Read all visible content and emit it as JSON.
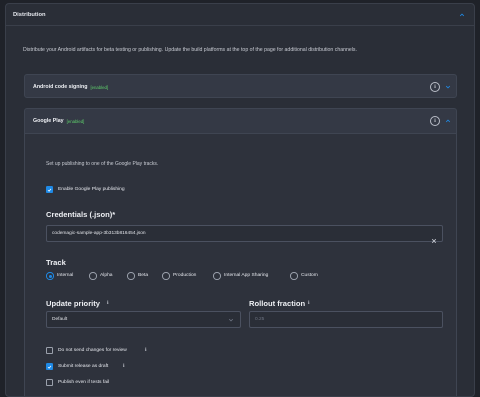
{
  "panel": {
    "title": "Distribution",
    "intro": "Distribute your Android artifacts for beta testing or publishing. Update the build platforms at the top of the page for additional distribution channels."
  },
  "signing": {
    "title": "Android code signing",
    "status": "[enabled]"
  },
  "google_play": {
    "title": "Google Play",
    "status": "[enabled]",
    "description": "Set up publishing to one of the Google Play tracks.",
    "enable_label": "Enable Google Play publishing",
    "enable_checked": true,
    "credentials": {
      "label": "Credentials (.json)*",
      "value": "codemagic-sample-app-3b313b816454.json"
    },
    "track": {
      "label": "Track",
      "options": [
        "Internal",
        "Alpha",
        "Beta",
        "Production",
        "Internal App Sharing",
        "Custom"
      ],
      "selected": "Internal"
    },
    "update_priority": {
      "label": "Update priority",
      "value": "Default"
    },
    "rollout_fraction": {
      "label": "Rollout fraction",
      "placeholder": "0.25"
    },
    "options": [
      {
        "label": "Do not send changes for review",
        "checked": false
      },
      {
        "label": "Submit release as draft",
        "checked": true
      },
      {
        "label": "Publish even if tests fail",
        "checked": false
      }
    ]
  },
  "colors": {
    "accent": "#1f8ae6",
    "enabled": "#5ecf6b",
    "background": "#1f2229"
  },
  "icons": [
    "chevron-up-icon",
    "chevron-down-icon",
    "info-icon",
    "check-icon",
    "close-icon"
  ]
}
